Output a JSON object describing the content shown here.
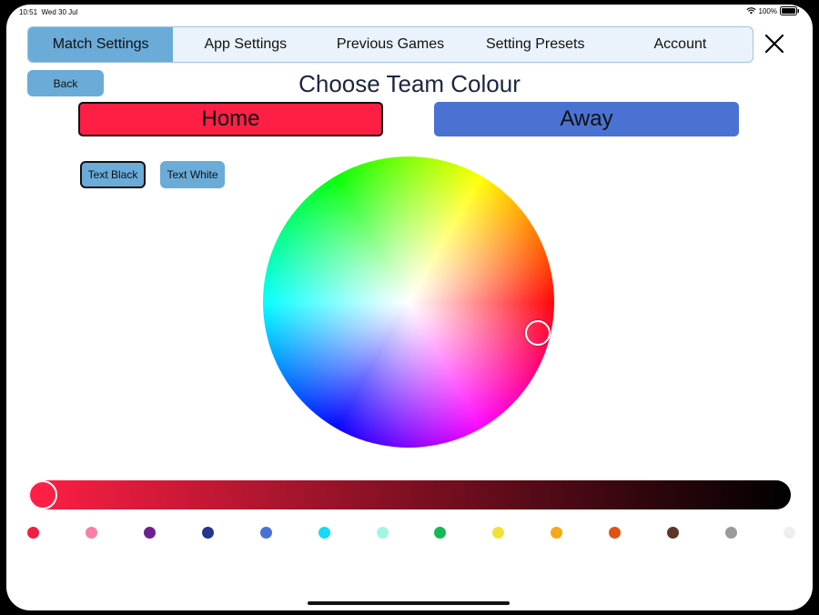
{
  "status_bar": {
    "time": "10:51",
    "date": "Wed 30 Jul",
    "battery": "100%",
    "wifi_icon": "wifi-icon",
    "battery_icon": "battery-icon"
  },
  "tabs": [
    {
      "label": "Match Settings",
      "active": true
    },
    {
      "label": "App Settings",
      "active": false
    },
    {
      "label": "Previous Games",
      "active": false
    },
    {
      "label": "Setting Presets",
      "active": false
    },
    {
      "label": "Account",
      "active": false
    }
  ],
  "close_icon": "close-icon",
  "back_label": "Back",
  "title": "Choose Team Colour",
  "teams": {
    "home_label": "Home",
    "away_label": "Away",
    "home_color": "#ff1f45",
    "away_color": "#4a72d3"
  },
  "text_buttons": {
    "black_label": "Text Black",
    "white_label": "Text White"
  },
  "colors": {
    "accent": "#6aabd8",
    "selected": "#ff1f45"
  },
  "brightness": 1.0,
  "swatches": [
    "#f0213f",
    "#f77fa6",
    "#6d2190",
    "#26358d",
    "#4a72d3",
    "#17d9f5",
    "#a1f6e3",
    "#16b756",
    "#f2e13a",
    "#f4a916",
    "#df5315",
    "#5c3729",
    "#9a9a9a",
    "#eeeeee"
  ]
}
